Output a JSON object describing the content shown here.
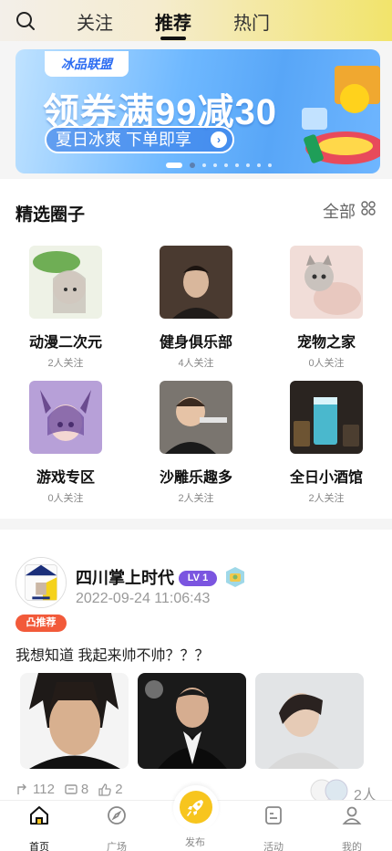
{
  "top_nav": {
    "tabs": [
      {
        "label": "关注"
      },
      {
        "label": "推荐",
        "active": true
      },
      {
        "label": "热门"
      }
    ],
    "search_icon": "search-icon"
  },
  "banner": {
    "brand": "冰品联盟",
    "headline": "领券满99减30",
    "subline": "夏日冰爽 下单即享",
    "arrow_icon": "chevron-right-icon",
    "slides_total": 9,
    "slide_active": 1
  },
  "circles_section": {
    "title": "精选圈子",
    "all_label": "全部",
    "all_icon": "grid-icon",
    "items": [
      {
        "name": "动漫二次元",
        "followers": "2人关注"
      },
      {
        "name": "健身俱乐部",
        "followers": "4人关注"
      },
      {
        "name": "宠物之家",
        "followers": "0人关注"
      },
      {
        "name": "游戏专区",
        "followers": "0人关注"
      },
      {
        "name": "沙雕乐趣多",
        "followers": "2人关注"
      },
      {
        "name": "全日小酒馆",
        "followers": "2人关注"
      }
    ]
  },
  "post": {
    "author": "四川掌上时代",
    "level": "LV 1",
    "time": "2022-09-24 11:06:43",
    "badge": "推荐",
    "text": "我想知道 我起来帅不帅？？？",
    "stats": {
      "views": "112",
      "comments": "8",
      "likes": "2"
    },
    "likers_count": "2人"
  },
  "bottom_nav": {
    "items": [
      {
        "label": "首页",
        "icon": "home-icon",
        "active": true
      },
      {
        "label": "广场",
        "icon": "compass-icon"
      },
      {
        "label": "发布",
        "icon": "rocket-icon"
      },
      {
        "label": "活动",
        "icon": "activity-icon"
      },
      {
        "label": "我的",
        "icon": "profile-icon"
      }
    ]
  },
  "colors": {
    "accent_yellow": "#f7c51e",
    "level_purple": "#7b55e0",
    "recommend_red": "#f25a3a",
    "banner_blue": "#58a6f7"
  }
}
